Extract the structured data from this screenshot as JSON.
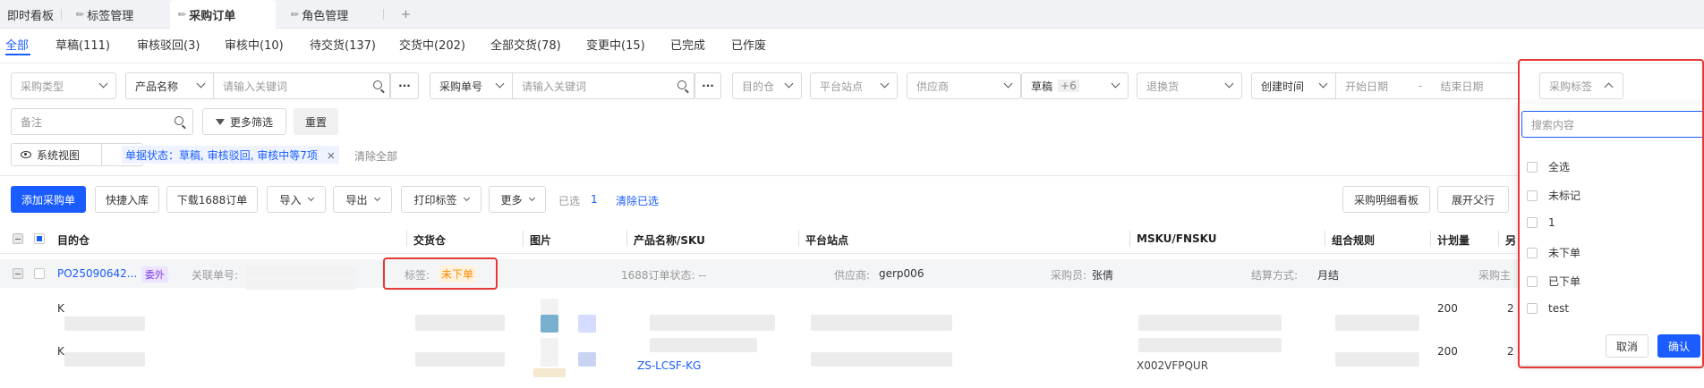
{
  "tabs": [
    {
      "label": "即时看板",
      "pinned": false
    },
    {
      "label": "标签管理",
      "pinned": true
    },
    {
      "label": "采购订单",
      "pinned": true,
      "active": true
    },
    {
      "label": "角色管理",
      "pinned": true
    }
  ],
  "add_tab": "+",
  "status_tabs": [
    "全部",
    "草稿(111)",
    "审核驳回(3)",
    "审核中(10)",
    "待交货(137)",
    "交货中(202)",
    "全部交货(78)",
    "变更中(15)",
    "已完成",
    "已作废"
  ],
  "filters": {
    "purchase_type": "采购类型",
    "product_name_select": "产品名称",
    "keyword_placeholder_1": "请输入关键词",
    "more_dots": "···",
    "po_number_select": "采购单号",
    "keyword_placeholder_2": "请输入关键词",
    "warehouse": "目的仓",
    "platform_site": "平台站点",
    "supplier": "供应商",
    "draft_label": "草稿",
    "draft_more": "+6",
    "return_exchange": "退换货",
    "created_time": "创建时间",
    "start_date": "开始日期",
    "date_sep": "-",
    "end_date": "结束日期",
    "purchase_tag": "采购标签",
    "remark_placeholder": "备注",
    "more_filters": "更多筛选",
    "reset": "重置",
    "system_view": "系统视图",
    "active_filter": "单据状态：草稿, 审核驳回, 审核中等7项",
    "clear_all": "清除全部"
  },
  "toolbar": {
    "add_po": "添加采购单",
    "quick_stockin": "快捷入库",
    "download_1688": "下载1688订单",
    "import": "导入",
    "export": "导出",
    "print_label": "打印标签",
    "more": "更多",
    "selected_label": "已选",
    "selected_count": "1",
    "clear_selected": "清除已选",
    "detail_board": "采购明细看板",
    "expand_rows": "展开父行"
  },
  "table": {
    "headers": [
      "目的仓",
      "交货仓",
      "图片",
      "产品名称/SKU",
      "平台站点",
      "MSKU/FNSKU",
      "组合规则",
      "计划量",
      "另"
    ],
    "group_row": {
      "po_number": "PO25090642...",
      "tag": "委外",
      "related_label": "关联单号:",
      "tag_label": "标签:",
      "tag_value": "未下单",
      "order_1688_status": "1688订单状态: --",
      "supplier_label": "供应商:",
      "supplier": "gerp006",
      "buyer_label": "采购员:",
      "buyer": "张倩",
      "settlement_label": "结算方式:",
      "settlement": "月结",
      "purchase_main_label": "采购主"
    },
    "rows": [
      {
        "warehouse": "K",
        "plan_qty": "200",
        "extra": "2"
      },
      {
        "warehouse": "K",
        "plan_qty": "200",
        "extra": "2",
        "sku_partial": "ZS-LCSF-KG",
        "msku_partial": "X002VFPQUR"
      }
    ]
  },
  "dropdown": {
    "search_placeholder": "搜索内容",
    "options": [
      "全选",
      "未标记",
      "1",
      "未下单",
      "已下单",
      "test"
    ],
    "cancel": "取消",
    "confirm": "确认"
  },
  "colors": {
    "primary": "#1a5cff",
    "highlight_box": "#e53935",
    "tag_orange": "#ff8a00",
    "tag_purple": "#7b3fe4"
  }
}
